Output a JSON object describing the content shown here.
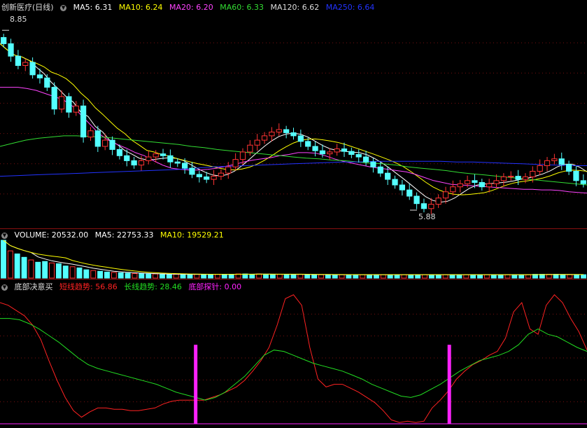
{
  "price": {
    "title": "创新医疗(日线)",
    "ma": [
      {
        "label": "MA5:",
        "value": "6.31",
        "color": "#ffffff"
      },
      {
        "label": "MA10:",
        "value": "6.24",
        "color": "#ffff00"
      },
      {
        "label": "MA20:",
        "value": "6.20",
        "color": "#ff44ff"
      },
      {
        "label": "MA60:",
        "value": "6.33",
        "color": "#33dd33"
      },
      {
        "label": "MA120:",
        "value": "6.62",
        "color": "#dddddd"
      },
      {
        "label": "MA250:",
        "value": "6.64",
        "color": "#2233ff"
      }
    ],
    "high_label": "8.85",
    "low_label": "5.88",
    "up_color": "#ff3333",
    "down_color": "#54ffff"
  },
  "volume": {
    "label": "VOLUME:",
    "value": "20532.00",
    "ma5_label": "MA5:",
    "ma5_value": "22753.33",
    "ma10_label": "MA10:",
    "ma10_value": "19529.21"
  },
  "indicator": {
    "name": "底部决意买",
    "short_label": "短线趋势:",
    "short_value": "56.86",
    "long_label": "长线趋势:",
    "long_value": "28.46",
    "probe_label": "底部探针:",
    "probe_value": "0.00",
    "short_color": "#ff2222",
    "long_color": "#22dd22",
    "probe_color": "#ff22ff"
  },
  "chart_data": [
    {
      "type": "candlestick",
      "ylim": [
        5.7,
        9.1
      ],
      "high_marker": 8.85,
      "low_marker": 5.88,
      "closes": [
        8.6,
        8.4,
        8.25,
        8.3,
        8.1,
        8.05,
        7.9,
        7.55,
        7.75,
        7.5,
        7.6,
        7.1,
        7.2,
        6.95,
        7.05,
        6.9,
        6.8,
        6.72,
        6.65,
        6.72,
        6.78,
        6.83,
        6.8,
        6.7,
        6.68,
        6.6,
        6.5,
        6.46,
        6.42,
        6.47,
        6.52,
        6.62,
        6.74,
        6.86,
        6.97,
        7.05,
        7.12,
        7.18,
        7.22,
        7.17,
        7.12,
        7.03,
        6.95,
        6.88,
        6.83,
        6.86,
        6.91,
        6.87,
        6.82,
        6.78,
        6.7,
        6.62,
        6.52,
        6.42,
        6.33,
        6.25,
        6.15,
        6.03,
        5.95,
        6.02,
        6.12,
        6.22,
        6.3,
        6.35,
        6.4,
        6.37,
        6.3,
        6.35,
        6.4,
        6.46,
        6.47,
        6.42,
        6.46,
        6.55,
        6.64,
        6.72,
        6.75,
        6.66,
        6.55,
        6.4,
        6.35
      ],
      "ma20": [
        7.9,
        7.9,
        7.9,
        7.88,
        7.85,
        7.8,
        7.75,
        7.7,
        7.6,
        7.45,
        7.3,
        7.15,
        7.05,
        6.98,
        6.92,
        6.85,
        6.8,
        6.72,
        6.65,
        6.6,
        6.58,
        6.57,
        6.57,
        6.58,
        6.6,
        6.63,
        6.66,
        6.7,
        6.73,
        6.75,
        6.77,
        6.8,
        6.82,
        6.85,
        6.85,
        6.84,
        6.8,
        6.75,
        6.71,
        6.68,
        6.65,
        6.62,
        6.6,
        6.58,
        6.56,
        6.54,
        6.5,
        6.45,
        6.4,
        6.37,
        6.34,
        6.33,
        6.32,
        6.31,
        6.3,
        6.29,
        6.28,
        6.27,
        6.26,
        6.26,
        6.25,
        6.25,
        6.24,
        6.22,
        6.21,
        6.2
      ],
      "ma60": [
        6.95,
        7.0,
        7.05,
        7.08,
        7.1,
        7.12,
        7.12,
        7.11,
        7.1,
        7.08,
        7.06,
        7.04,
        7.02,
        7.0,
        6.98,
        6.95,
        6.93,
        6.9,
        6.88,
        6.86,
        6.84,
        6.82,
        6.8,
        6.78,
        6.76,
        6.75,
        6.73,
        6.72,
        6.7,
        6.68,
        6.67,
        6.65,
        6.62,
        6.6,
        6.58,
        6.56,
        6.53,
        6.51,
        6.49,
        6.47,
        6.45,
        6.43,
        6.41,
        6.39,
        6.37,
        6.35,
        6.33
      ],
      "ma250": [
        6.47,
        6.48,
        6.49,
        6.5,
        6.51,
        6.52,
        6.53,
        6.54,
        6.55,
        6.56,
        6.57,
        6.58,
        6.6,
        6.62,
        6.63,
        6.64,
        6.65,
        6.66,
        6.67,
        6.68,
        6.69,
        6.7,
        6.7,
        6.71,
        6.71,
        6.71,
        6.71,
        6.71,
        6.7,
        6.7,
        6.69,
        6.68,
        6.67,
        6.66,
        6.65,
        6.64,
        6.64
      ]
    },
    {
      "type": "bar",
      "values": [
        100,
        72,
        64,
        55,
        48,
        42,
        44,
        40,
        38,
        32,
        30,
        27,
        22,
        20,
        18,
        16,
        15,
        14,
        13,
        12,
        12,
        11,
        11,
        10,
        10,
        10,
        10,
        10,
        10,
        10,
        10,
        10,
        10,
        10,
        11,
        11,
        10,
        11,
        10,
        10,
        10,
        10,
        10,
        10,
        9,
        9,
        9,
        9,
        9,
        9,
        9,
        9,
        9,
        9,
        9,
        9,
        9,
        9,
        9,
        9,
        9,
        9,
        9,
        9,
        9,
        9,
        9,
        9,
        9,
        9,
        9,
        9,
        9,
        9,
        9,
        9,
        9,
        10,
        10,
        10,
        10,
        9,
        9,
        9,
        9
      ],
      "ylim": [
        0,
        100
      ]
    },
    {
      "type": "line",
      "ylim": [
        0,
        100
      ],
      "series": [
        {
          "name": "短线趋势",
          "values": [
            92,
            90,
            86,
            82,
            75,
            64,
            48,
            33,
            20,
            10,
            5,
            9,
            12,
            12,
            11,
            11,
            10,
            10,
            11,
            12,
            15,
            17,
            18,
            18,
            18,
            18,
            20,
            22,
            25,
            28,
            33,
            40,
            48,
            58,
            75,
            95,
            98,
            90,
            58,
            34,
            28,
            30,
            30,
            27,
            24,
            20,
            16,
            10,
            3,
            1,
            2,
            1,
            2,
            12,
            18,
            25,
            34,
            40,
            45,
            48,
            52,
            55,
            65,
            85,
            92,
            72,
            68,
            90,
            98,
            92,
            80,
            70,
            56
          ]
        },
        {
          "name": "长线趋势",
          "values": [
            80,
            80,
            79,
            76,
            72,
            67,
            62,
            56,
            50,
            45,
            42,
            40,
            38,
            36,
            34,
            32,
            30,
            27,
            24,
            22,
            20,
            18,
            20,
            24,
            30,
            36,
            44,
            52,
            56,
            55,
            52,
            49,
            46,
            44,
            42,
            40,
            37,
            34,
            30,
            27,
            24,
            21,
            20,
            22,
            26,
            30,
            35,
            40,
            44,
            48,
            50,
            52,
            55,
            60,
            68,
            72,
            68,
            66,
            62,
            58,
            55
          ]
        },
        {
          "name": "底部探针",
          "values": [
            0,
            0,
            0,
            0,
            0,
            0,
            0,
            0,
            0,
            0,
            0,
            0,
            0,
            0,
            0,
            0,
            0,
            0,
            0,
            0,
            0,
            0,
            0,
            0,
            0,
            0,
            0,
            60,
            0,
            0,
            0,
            0,
            0,
            0,
            0,
            0,
            0,
            0,
            0,
            0,
            0,
            0,
            0,
            0,
            0,
            0,
            0,
            0,
            0,
            0,
            0,
            0,
            0,
            0,
            0,
            0,
            0,
            0,
            0,
            0,
            0,
            0,
            60,
            0,
            0,
            0,
            0,
            0,
            0,
            0,
            0,
            0,
            0,
            0,
            0,
            0,
            0,
            0,
            0,
            0,
            0,
            0
          ]
        }
      ]
    }
  ]
}
